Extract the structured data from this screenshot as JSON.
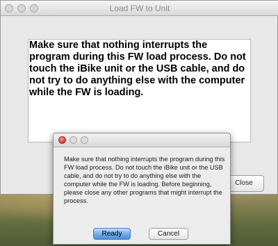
{
  "main_window": {
    "title": "Load FW to Unit",
    "message": "Make sure that nothing interrupts the program during this FW load process.  Do not touch the iBike unit or the USB cable, and do not try to do anything else with the computer while the FW is loading.",
    "close_label": "Close"
  },
  "dialog": {
    "message": "Make sure that nothing interrupts the program during this FW load process.  Do not touch the iBike unit or the USB cable, and do not try to do anything else with the computer while the FW is loading.  Before beginning, please close any other programs that might interrupt the process.",
    "ready_label": "Ready",
    "cancel_label": "Cancel"
  },
  "colors": {
    "default_button": "#6ea8ea",
    "close_dot": "#e0453a"
  }
}
